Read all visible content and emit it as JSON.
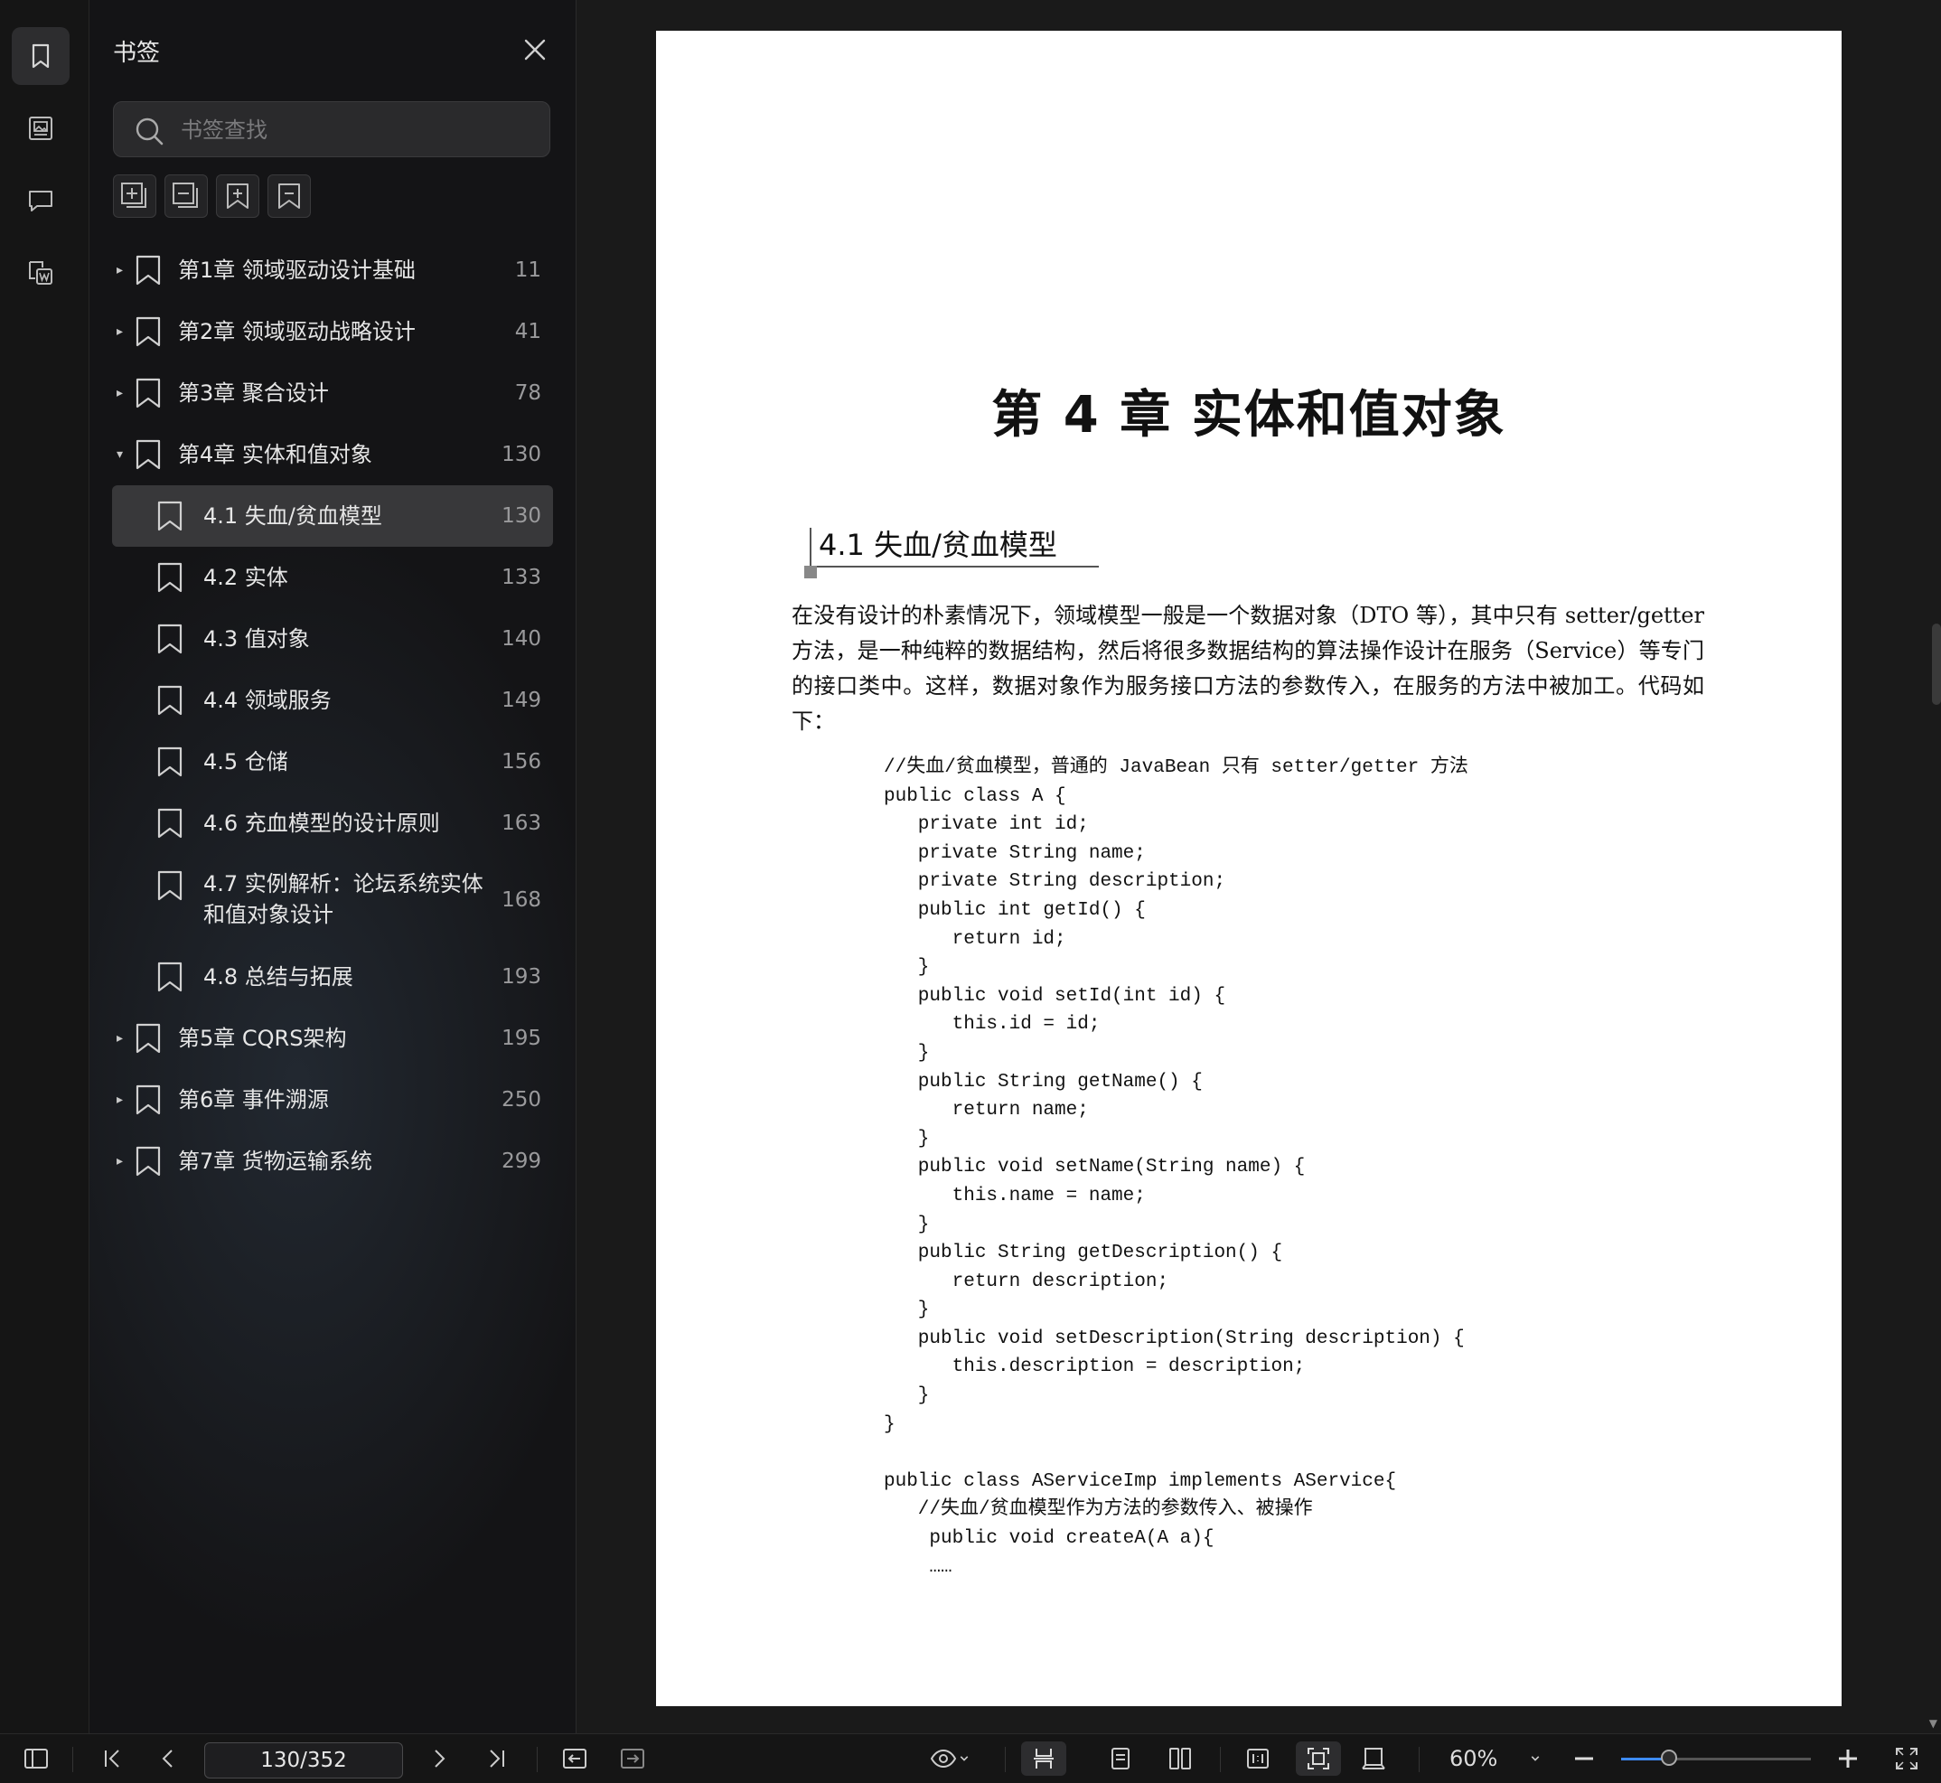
{
  "sidebar": {
    "title": "书签",
    "search_placeholder": "书签查找",
    "rail_icons": [
      "bookmark-icon",
      "image-icon",
      "comment-icon",
      "word-export-icon"
    ],
    "tool_icons": [
      "expand-all-icon",
      "collapse-all-icon",
      "add-bookmark-icon",
      "delete-bookmark-icon"
    ],
    "items": [
      {
        "label": "第1章 领域驱动设计基础",
        "page": "11",
        "level": 0,
        "caret": "▸"
      },
      {
        "label": "第2章 领域驱动战略设计",
        "page": "41",
        "level": 0,
        "caret": "▸"
      },
      {
        "label": "第3章 聚合设计",
        "page": "78",
        "level": 0,
        "caret": "▸"
      },
      {
        "label": "第4章 实体和值对象",
        "page": "130",
        "level": 0,
        "caret": "▾"
      },
      {
        "label": "4.1 失血/贫血模型",
        "page": "130",
        "level": 1,
        "selected": true
      },
      {
        "label": "4.2 实体",
        "page": "133",
        "level": 1
      },
      {
        "label": "4.3 值对象",
        "page": "140",
        "level": 1
      },
      {
        "label": "4.4 领域服务",
        "page": "149",
        "level": 1
      },
      {
        "label": "4.5 仓储",
        "page": "156",
        "level": 1
      },
      {
        "label": "4.6 充血模型的设计原则",
        "page": "163",
        "level": 1
      },
      {
        "label": "4.7 实例解析：论坛系统实体和值对象设计",
        "page": "168",
        "level": 1,
        "tall": true
      },
      {
        "label": "4.8 总结与拓展",
        "page": "193",
        "level": 1
      },
      {
        "label": "第5章 CQRS架构",
        "page": "195",
        "level": 0,
        "caret": "▸"
      },
      {
        "label": "第6章 事件溯源",
        "page": "250",
        "level": 0,
        "caret": "▸"
      },
      {
        "label": "第7章 货物运输系统",
        "page": "299",
        "level": 0,
        "caret": "▸"
      }
    ]
  },
  "document": {
    "chapter_title": "第 4 章    实体和值对象",
    "section_title": "4.1    失血/贫血模型",
    "paragraph": "在没有设计的朴素情况下，领域模型一般是一个数据对象（DTO 等），其中只有 setter/getter 方法，是一种纯粹的数据结构，然后将很多数据结构的算法操作设计在服务（Service）等专门的接口类中。这样，数据对象作为服务接口方法的参数传入，在服务的方法中被加工。代码如下：",
    "code": "//失血/贫血模型，普通的 JavaBean 只有 setter/getter 方法\npublic class A {\n   private int id;\n   private String name;\n   private String description;\n   public int getId() {\n      return id;\n   }\n   public void setId(int id) {\n      this.id = id;\n   }\n   public String getName() {\n      return name;\n   }\n   public void setName(String name) {\n      this.name = name;\n   }\n   public String getDescription() {\n      return description;\n   }\n   public void setDescription(String description) {\n      this.description = description;\n   }\n}\n\npublic class AServiceImp implements AService{\n   //失血/贫血模型作为方法的参数传入、被操作\n    public void createA(A a){\n    ……"
  },
  "bottombar": {
    "page_indicator": "130/352",
    "zoom_label": "60%",
    "zoom_fraction": 0.25
  }
}
